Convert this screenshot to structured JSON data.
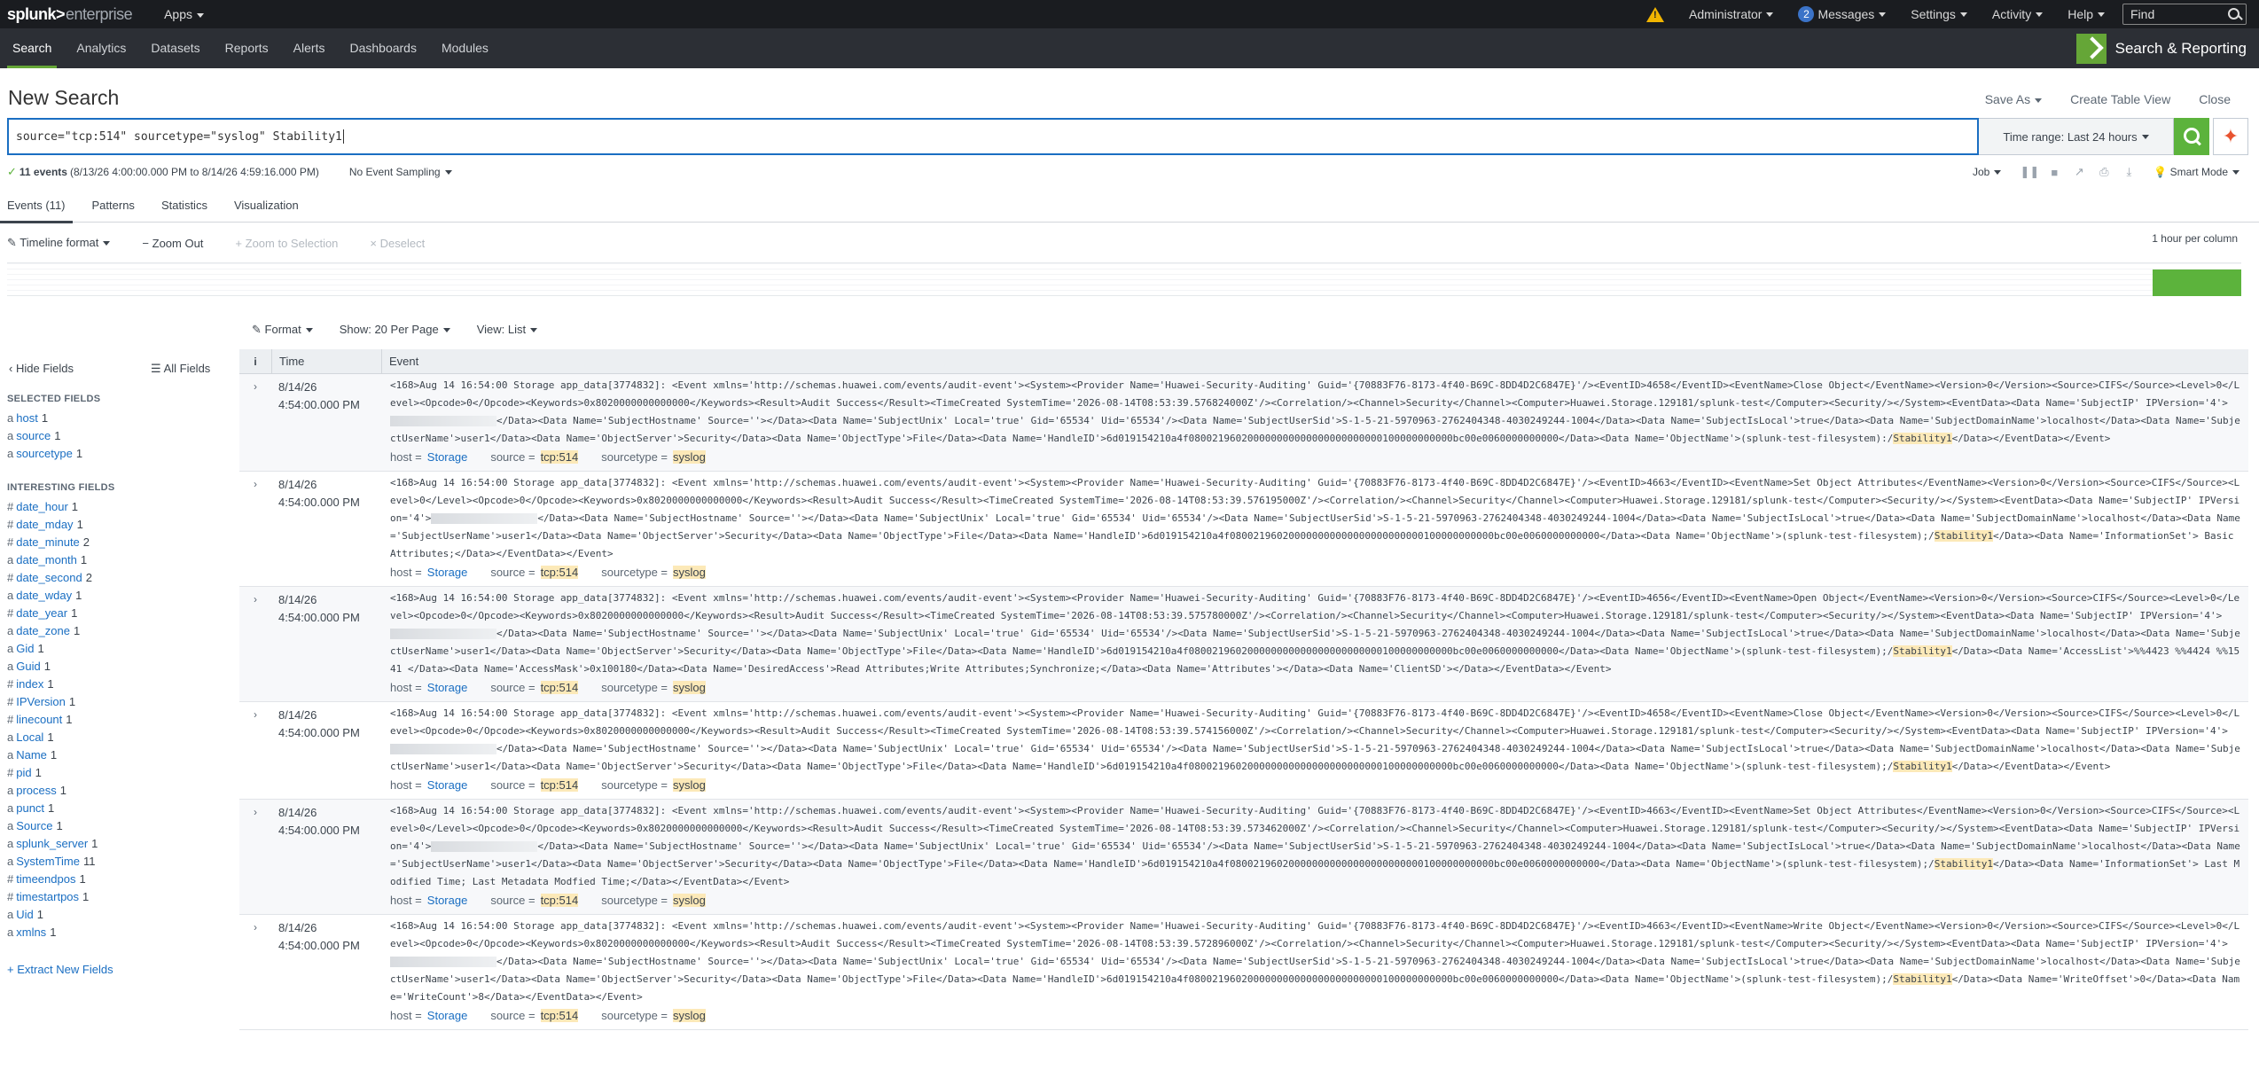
{
  "topbar": {
    "logo_brand": "splunk>",
    "logo_product": "enterprise",
    "apps": "Apps",
    "administrator": "Administrator",
    "messages_count": "2",
    "messages": "Messages",
    "settings": "Settings",
    "activity": "Activity",
    "help": "Help",
    "find_placeholder": "Find"
  },
  "appbar": {
    "tabs": [
      "Search",
      "Analytics",
      "Datasets",
      "Reports",
      "Alerts",
      "Dashboards",
      "Modules"
    ],
    "app_title": "Search & Reporting"
  },
  "search": {
    "page_title": "New Search",
    "save_as": "Save As",
    "create_table_view": "Create Table View",
    "close": "Close",
    "query": "source=\"tcp:514\" sourcetype=\"syslog\" Stability1",
    "time_range": "Time range: Last 24 hours"
  },
  "status": {
    "events_count": "11 events",
    "time_span": "(8/13/26 4:00:00.000 PM to 8/14/26 4:59:16.000 PM)",
    "sampling": "No Event Sampling",
    "job": "Job",
    "smart_mode": "Smart Mode"
  },
  "result_tabs": [
    "Events (11)",
    "Patterns",
    "Statistics",
    "Visualization"
  ],
  "timeline": {
    "format": "Timeline format",
    "zoom_out": "Zoom Out",
    "zoom_selection": "Zoom to Selection",
    "deselect": "Deselect",
    "scale": "1 hour per column"
  },
  "view_controls": {
    "format": "Format",
    "per_page": "Show: 20 Per Page",
    "view": "View: List"
  },
  "sidebar": {
    "hide_fields": "Hide Fields",
    "all_fields": "All Fields",
    "selected_heading": "SELECTED FIELDS",
    "selected": [
      {
        "type": "a",
        "name": "host",
        "count": "1"
      },
      {
        "type": "a",
        "name": "source",
        "count": "1"
      },
      {
        "type": "a",
        "name": "sourcetype",
        "count": "1"
      }
    ],
    "interesting_heading": "INTERESTING FIELDS",
    "interesting": [
      {
        "type": "#",
        "name": "date_hour",
        "count": "1"
      },
      {
        "type": "#",
        "name": "date_mday",
        "count": "1"
      },
      {
        "type": "#",
        "name": "date_minute",
        "count": "2"
      },
      {
        "type": "a",
        "name": "date_month",
        "count": "1"
      },
      {
        "type": "#",
        "name": "date_second",
        "count": "2"
      },
      {
        "type": "a",
        "name": "date_wday",
        "count": "1"
      },
      {
        "type": "#",
        "name": "date_year",
        "count": "1"
      },
      {
        "type": "a",
        "name": "date_zone",
        "count": "1"
      },
      {
        "type": "a",
        "name": "Gid",
        "count": "1"
      },
      {
        "type": "a",
        "name": "Guid",
        "count": "1"
      },
      {
        "type": "#",
        "name": "index",
        "count": "1"
      },
      {
        "type": "#",
        "name": "IPVersion",
        "count": "1"
      },
      {
        "type": "#",
        "name": "linecount",
        "count": "1"
      },
      {
        "type": "a",
        "name": "Local",
        "count": "1"
      },
      {
        "type": "a",
        "name": "Name",
        "count": "1"
      },
      {
        "type": "#",
        "name": "pid",
        "count": "1"
      },
      {
        "type": "a",
        "name": "process",
        "count": "1"
      },
      {
        "type": "a",
        "name": "punct",
        "count": "1"
      },
      {
        "type": "a",
        "name": "Source",
        "count": "1"
      },
      {
        "type": "a",
        "name": "splunk_server",
        "count": "1"
      },
      {
        "type": "a",
        "name": "SystemTime",
        "count": "11"
      },
      {
        "type": "#",
        "name": "timeendpos",
        "count": "1"
      },
      {
        "type": "#",
        "name": "timestartpos",
        "count": "1"
      },
      {
        "type": "a",
        "name": "Uid",
        "count": "1"
      },
      {
        "type": "a",
        "name": "xmlns",
        "count": "1"
      }
    ],
    "extract": "+ Extract New Fields"
  },
  "table": {
    "info_header": "i",
    "time_header": "Time",
    "event_header": "Event",
    "meta_host_key": "host =",
    "meta_source_key": "source =",
    "meta_sourcetype_key": "sourcetype =",
    "meta_host_val": "Storage",
    "meta_source_val": "tcp:514",
    "meta_sourcetype_val": "syslog",
    "events": [
      {
        "date": "8/14/26",
        "time": "4:54:00.000 PM",
        "pre": "<168>Aug 14 16:54:00 Storage app_data[3774832]: <Event xmlns='http://schemas.huawei.com/events/audit-event'><System><Provider Name='Huawei-Security-Auditing' Guid='{70883F76-8173-4f40-B69C-8DD4D2C6847E}'/><EventID>4658</EventID><EventName>Close Object</EventName><Version>0</Version><Source>CIFS</Source><Level>0</Level><Opcode>0</Opcode><Keywords>0x8020000000000000</Keywords><Result>Audit Success</Result><TimeCreated SystemTime='2026-08-14T08:53:39.576824000Z'/><Correlation/><Channel>Security</Channel><Computer>Huawei.Storage.129181/splunk-test</Computer><Security/></System><EventData><Data Name='SubjectIP' IPVersion='4'>",
        "post": "</Data><Data Name='SubjectHostname' Source=''></Data><Data Name='SubjectUnix' Local='true' Gid='65534' Uid='65534'/><Data Name='SubjectUserSid'>S-1-5-21-5970963-2762404348-4030249244-1004</Data><Data Name='SubjectIsLocal'>true</Data><Data Name='SubjectDomainName'>localhost</Data><Data Name='SubjectUserName'>user1</Data><Data Name='ObjectServer'>Security</Data><Data Name='ObjectType'>File</Data><Data Name='HandleID'>6d019154210a4f080021960200000000000000000000000100000000000bc00e0060000000000</Data><Data Name='ObjectName'>(splunk-test-filesystem):/",
        "tail": "</Data></EventData></Event>"
      },
      {
        "date": "8/14/26",
        "time": "4:54:00.000 PM",
        "pre": "<168>Aug 14 16:54:00 Storage app_data[3774832]: <Event xmlns='http://schemas.huawei.com/events/audit-event'><System><Provider Name='Huawei-Security-Auditing' Guid='{70883F76-8173-4f40-B69C-8DD4D2C6847E}'/><EventID>4663</EventID><EventName>Set Object Attributes</EventName><Version>0</Version><Source>CIFS</Source><Level>0</Level><Opcode>0</Opcode><Keywords>0x8020000000000000</Keywords><Result>Audit Success</Result><TimeCreated SystemTime='2026-08-14T08:53:39.576195000Z'/><Correlation/><Channel>Security</Channel><Computer>Huawei.Storage.129181/splunk-test</Computer><Security/></System><EventData><Data Name='SubjectIP' IPVersion='4'>",
        "post": "</Data><Data Name='SubjectHostname' Source=''></Data><Data Name='SubjectUnix' Local='true' Gid='65534' Uid='65534'/><Data Name='SubjectUserSid'>S-1-5-21-5970963-2762404348-4030249244-1004</Data><Data Name='SubjectIsLocal'>true</Data><Data Name='SubjectDomainName'>localhost</Data><Data Name='SubjectUserName'>user1</Data><Data Name='ObjectServer'>Security</Data><Data Name='ObjectType'>File</Data><Data Name='HandleID'>6d019154210a4f080021960200000000000000000000000100000000000bc00e0060000000000</Data><Data Name='ObjectName'>(splunk-test-filesystem);/",
        "tail": "</Data><Data Name='InformationSet'> Basic Attributes;</Data></EventData></Event>"
      },
      {
        "date": "8/14/26",
        "time": "4:54:00.000 PM",
        "pre": "<168>Aug 14 16:54:00 Storage app_data[3774832]: <Event xmlns='http://schemas.huawei.com/events/audit-event'><System><Provider Name='Huawei-Security-Auditing' Guid='{70883F76-8173-4f40-B69C-8DD4D2C6847E}'/><EventID>4656</EventID><EventName>Open Object</EventName><Version>0</Version><Source>CIFS</Source><Level>0</Level><Opcode>0</Opcode><Keywords>0x8020000000000000</Keywords><Result>Audit Success</Result><TimeCreated SystemTime='2026-08-14T08:53:39.575780000Z'/><Correlation/><Channel>Security</Channel><Computer>Huawei.Storage.129181/splunk-test</Computer><Security/></System><EventData><Data Name='SubjectIP' IPVersion='4'>",
        "post": "</Data><Data Name='SubjectHostname' Source=''></Data><Data Name='SubjectUnix' Local='true' Gid='65534' Uid='65534'/><Data Name='SubjectUserSid'>S-1-5-21-5970963-2762404348-4030249244-1004</Data><Data Name='SubjectIsLocal'>true</Data><Data Name='SubjectDomainName'>localhost</Data><Data Name='SubjectUserName'>user1</Data><Data Name='ObjectServer'>Security</Data><Data Name='ObjectType'>File</Data><Data Name='HandleID'>6d019154210a4f080021960200000000000000000000000100000000000bc00e0060000000000</Data><Data Name='ObjectName'>(splunk-test-filesystem);/",
        "tail": "</Data><Data Name='AccessList'>%%4423 %%4424 %%1541 </Data><Data Name='AccessMask'>0x100180</Data><Data Name='DesiredAccess'>Read Attributes;Write Attributes;Synchronize;</Data><Data Name='Attributes'></Data><Data Name='ClientSD'></Data></EventData></Event>"
      },
      {
        "date": "8/14/26",
        "time": "4:54:00.000 PM",
        "pre": "<168>Aug 14 16:54:00 Storage app_data[3774832]: <Event xmlns='http://schemas.huawei.com/events/audit-event'><System><Provider Name='Huawei-Security-Auditing' Guid='{70883F76-8173-4f40-B69C-8DD4D2C6847E}'/><EventID>4658</EventID><EventName>Close Object</EventName><Version>0</Version><Source>CIFS</Source><Level>0</Level><Opcode>0</Opcode><Keywords>0x8020000000000000</Keywords><Result>Audit Success</Result><TimeCreated SystemTime='2026-08-14T08:53:39.574156000Z'/><Correlation/><Channel>Security</Channel><Computer>Huawei.Storage.129181/splunk-test</Computer><Security/></System><EventData><Data Name='SubjectIP' IPVersion='4'>",
        "post": "</Data><Data Name='SubjectHostname' Source=''></Data><Data Name='SubjectUnix' Local='true' Gid='65534' Uid='65534'/><Data Name='SubjectUserSid'>S-1-5-21-5970963-2762404348-4030249244-1004</Data><Data Name='SubjectIsLocal'>true</Data><Data Name='SubjectDomainName'>localhost</Data><Data Name='SubjectUserName'>user1</Data><Data Name='ObjectServer'>Security</Data><Data Name='ObjectType'>File</Data><Data Name='HandleID'>6d019154210a4f080021960200000000000000000000000100000000000bc00e0060000000000</Data><Data Name='ObjectName'>(splunk-test-filesystem);/",
        "tail": "</Data></EventData></Event>"
      },
      {
        "date": "8/14/26",
        "time": "4:54:00.000 PM",
        "pre": "<168>Aug 14 16:54:00 Storage app_data[3774832]: <Event xmlns='http://schemas.huawei.com/events/audit-event'><System><Provider Name='Huawei-Security-Auditing' Guid='{70883F76-8173-4f40-B69C-8DD4D2C6847E}'/><EventID>4663</EventID><EventName>Set Object Attributes</EventName><Version>0</Version><Source>CIFS</Source><Level>0</Level><Opcode>0</Opcode><Keywords>0x8020000000000000</Keywords><Result>Audit Success</Result><TimeCreated SystemTime='2026-08-14T08:53:39.573462000Z'/><Correlation/><Channel>Security</Channel><Computer>Huawei.Storage.129181/splunk-test</Computer><Security/></System><EventData><Data Name='SubjectIP' IPVersion='4'>",
        "post": "</Data><Data Name='SubjectHostname' Source=''></Data><Data Name='SubjectUnix' Local='true' Gid='65534' Uid='65534'/><Data Name='SubjectUserSid'>S-1-5-21-5970963-2762404348-4030249244-1004</Data><Data Name='SubjectIsLocal'>true</Data><Data Name='SubjectDomainName'>localhost</Data><Data Name='SubjectUserName'>user1</Data><Data Name='ObjectServer'>Security</Data><Data Name='ObjectType'>File</Data><Data Name='HandleID'>6d019154210a4f080021960200000000000000000000000100000000000bc00e0060000000000</Data><Data Name='ObjectName'>(splunk-test-filesystem);/",
        "tail": "</Data><Data Name='InformationSet'> Last Modified Time; Last Metadata Modfied Time;</Data></EventData></Event>"
      },
      {
        "date": "8/14/26",
        "time": "4:54:00.000 PM",
        "pre": "<168>Aug 14 16:54:00 Storage app_data[3774832]: <Event xmlns='http://schemas.huawei.com/events/audit-event'><System><Provider Name='Huawei-Security-Auditing' Guid='{70883F76-8173-4f40-B69C-8DD4D2C6847E}'/><EventID>4663</EventID><EventName>Write Object</EventName><Version>0</Version><Source>CIFS</Source><Level>0</Level><Opcode>0</Opcode><Keywords>0x8020000000000000</Keywords><Result>Audit Success</Result><TimeCreated SystemTime='2026-08-14T08:53:39.572896000Z'/><Correlation/><Channel>Security</Channel><Computer>Huawei.Storage.129181/splunk-test</Computer><Security/></System><EventData><Data Name='SubjectIP' IPVersion='4'>",
        "post": "</Data><Data Name='SubjectHostname' Source=''></Data><Data Name='SubjectUnix' Local='true' Gid='65534' Uid='65534'/><Data Name='SubjectUserSid'>S-1-5-21-5970963-2762404348-4030249244-1004</Data><Data Name='SubjectIsLocal'>true</Data><Data Name='SubjectDomainName'>localhost</Data><Data Name='SubjectUserName'>user1</Data><Data Name='ObjectServer'>Security</Data><Data Name='ObjectType'>File</Data><Data Name='HandleID'>6d019154210a4f080021960200000000000000000000000100000000000bc00e0060000000000</Data><Data Name='ObjectName'>(splunk-test-filesystem);/",
        "tail": "</Data><Data Name='WriteOffset'>0</Data><Data Name='WriteCount'>8</Data></EventData></Event>"
      }
    ],
    "highlight_term": "Stability1"
  },
  "colors": {
    "accent_green": "#5cb33c",
    "link_blue": "#1a6ec2",
    "topbar_bg": "#1a1c20",
    "appbar_bg": "#2c2f35",
    "highlight": "#fce9b8"
  }
}
